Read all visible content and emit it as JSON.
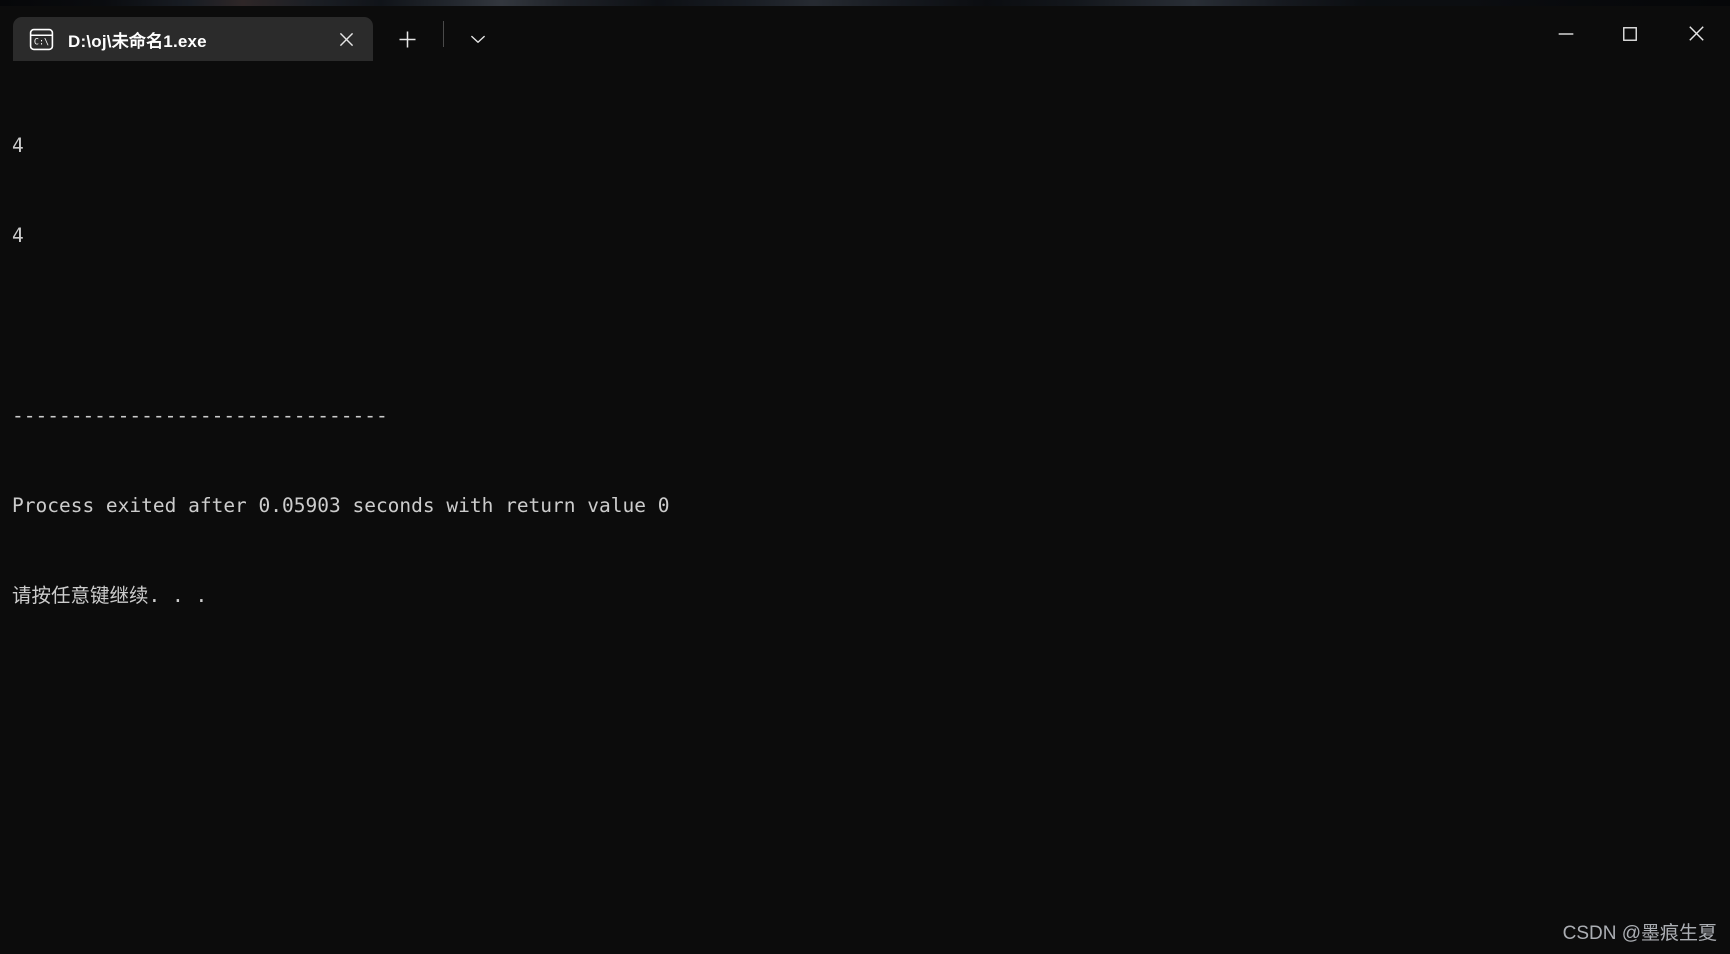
{
  "window": {
    "app": "windows-terminal",
    "background_color": "#0c0c0c",
    "tab_background_color": "#2b2b2b",
    "text_color": "#cccccc"
  },
  "tabstrip": {
    "tabs": [
      {
        "title": "D:\\oj\\未命名1.exe",
        "icon": "cmd-prompt-icon",
        "close_label": "✕",
        "active": true
      }
    ],
    "new_tab_label": "+",
    "dropdown_label": "⌄"
  },
  "window_controls": {
    "minimize_label": "—",
    "maximize_label": "□",
    "close_label": "✕"
  },
  "terminal": {
    "lines": [
      "4",
      "4",
      "",
      "--------------------------------",
      "Process exited after 0.05903 seconds with return value 0",
      "请按任意键继续. . ."
    ]
  },
  "watermark": {
    "text": "CSDN @墨痕生夏"
  }
}
